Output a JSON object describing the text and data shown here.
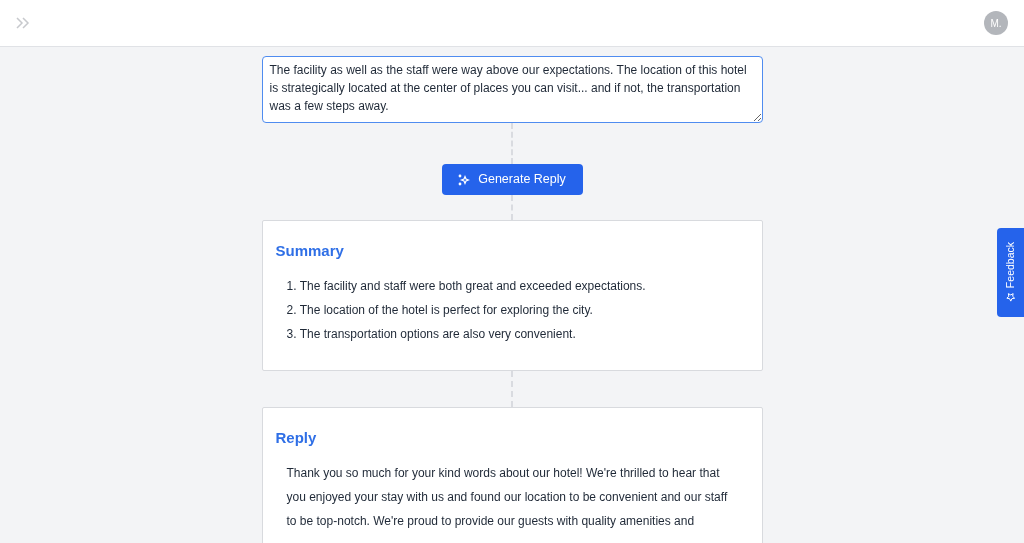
{
  "header": {
    "avatar": "M."
  },
  "review": {
    "value": "The facility as well as the staff were way above our expectations. The location of this hotel is strategically located at the center of places you can visit... and if not, the transportation was a few steps away."
  },
  "generate_button": {
    "label": "Generate Reply"
  },
  "summary": {
    "title": "Summary",
    "items": [
      "1. The facility and staff were both great and exceeded expectations.",
      "2. The location of the hotel is perfect for exploring the city.",
      "3. The transportation options are also very convenient."
    ]
  },
  "reply": {
    "title": "Reply",
    "text": "Thank you so much for your kind words about our hotel! We're thrilled to hear that you enjoyed your stay with us and found our location to be convenient and our staff to be top-notch. We're proud to provide our guests with quality amenities and"
  },
  "feedback_tab": {
    "label": "Feedback"
  }
}
